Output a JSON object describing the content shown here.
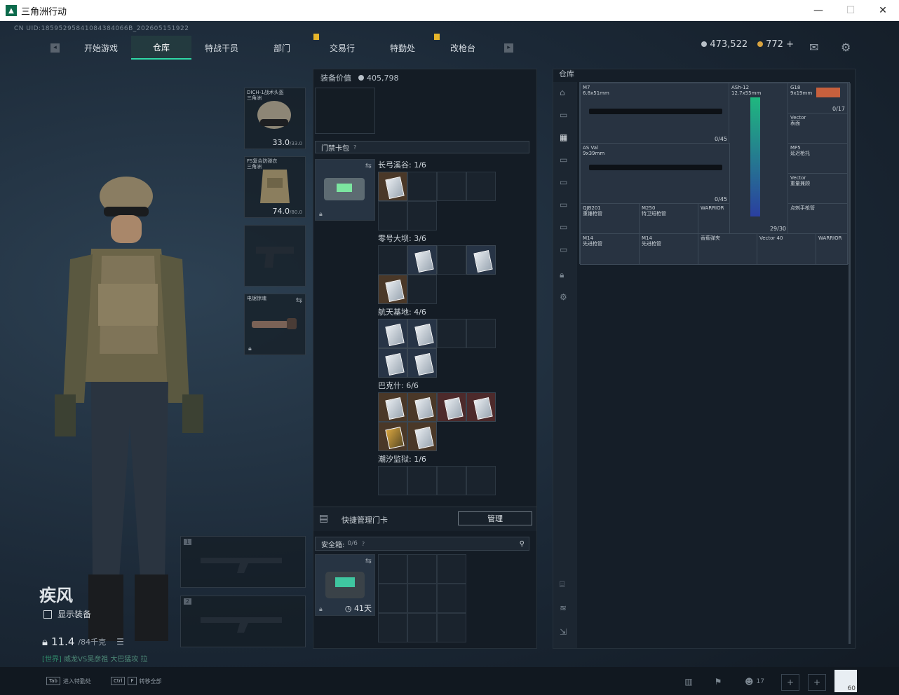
{
  "window": {
    "title": "三角洲行动",
    "minimize": "—",
    "maximize": "☐",
    "close": "✕"
  },
  "header": {
    "cnuid": "CN UID:18595295841084384066B_202605151922",
    "tabs": [
      "开始游戏",
      "仓库",
      "特战干员",
      "部门",
      "交易行",
      "特勤处",
      "改枪台"
    ],
    "active_tab": "仓库",
    "silver": "473,522",
    "gold": "772",
    "plus": "+"
  },
  "character": {
    "name": "疾风",
    "show_equipment": "显示装备",
    "weight": "11.4",
    "weight_max": "/84千克",
    "chat_channel": "[世界]",
    "chat_text": "威龙VS吴彦祖 大巴猛攻 拉"
  },
  "equipment": {
    "helmet": {
      "label": "DICH-1战术头盔",
      "label2": "三角洲",
      "value": "33.0",
      "max": "/33.0"
    },
    "armor": {
      "label": "FS复合防弹衣",
      "label2": "三角洲",
      "value": "74.0",
      "max": "/80.0"
    },
    "melee": {
      "label": "电锯惊魂"
    },
    "slot1": "1",
    "slot2": "2"
  },
  "middle": {
    "value_label": "装备价值",
    "value": "405,798",
    "keycard_section": "门禁卡包",
    "help": "?",
    "maps": [
      "长弓溪谷: 1/6",
      "零号大坝: 3/6",
      "航天基地: 4/6",
      "巴克什: 6/6",
      "潮汐监狱: 1/6"
    ],
    "quick_manage": "快捷管理门卡",
    "manage_btn": "管理",
    "safebox_label": "安全箱:",
    "safebox_count": "0/6",
    "safebox_days": "41天"
  },
  "warehouse": {
    "title": "仓库",
    "weapons": [
      {
        "name": "M7",
        "sub": "6.8x51mm",
        "count": "0/45"
      },
      {
        "name": "ASh-12",
        "sub": "12.7x55mm",
        "count": ""
      },
      {
        "name": "G18",
        "sub": "9x19mm",
        "count": "0/17"
      },
      {
        "name": "Vector",
        "sub": "表面",
        "count": ""
      },
      {
        "name": "AS Val",
        "sub": "9x39mm",
        "count": "0/45"
      },
      {
        "name": "MP5",
        "sub": "延迟枪托",
        "count": ""
      },
      {
        "name": "Vector",
        "sub": "重量兼顾",
        "count": ""
      },
      {
        "name": "QJB201",
        "sub": "重锤枪管",
        "count": ""
      },
      {
        "name": "M250",
        "sub": "特卫短枪管",
        "count": ""
      },
      {
        "name": "WARRIOR",
        "sub": "",
        "count": "29/30"
      },
      {
        "name": "点刺手枪管",
        "sub": "",
        "count": ""
      },
      {
        "name": "M14",
        "sub": "先进枪管",
        "count": ""
      },
      {
        "name": "M14",
        "sub": "先进枪管",
        "count": ""
      },
      {
        "name": "香蕉弹夹",
        "sub": "",
        "count": ""
      },
      {
        "name": "Vector 40",
        "sub": "",
        "count": ""
      },
      {
        "name": "WARRIOR",
        "sub": "",
        "count": ""
      }
    ]
  },
  "bottom": {
    "tab_key": "Tab",
    "tab_label": "进入特勤处",
    "ctrl_key": "Ctrl",
    "f_key": "F",
    "ctrl_label": "转移全部",
    "friends": "17",
    "avatar_level": "60"
  },
  "colors": {
    "accent": "#2fd8a5",
    "badge": "#e6b52a"
  }
}
